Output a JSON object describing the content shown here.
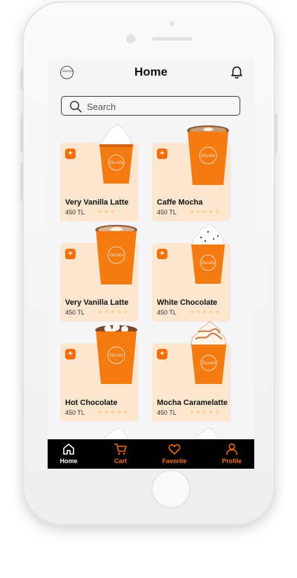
{
  "header": {
    "title": "Home",
    "logo_text": "Damla Coffee"
  },
  "search": {
    "placeholder": "Search",
    "value": ""
  },
  "products": [
    {
      "name": "Very Vanilla Latte",
      "price": "450 TL",
      "rating": 3,
      "topping": "cream"
    },
    {
      "name": "Caffe Mocha",
      "price": "450 TL",
      "rating": 5,
      "topping": "latte-art"
    },
    {
      "name": "Very Vanilla Latte",
      "price": "450 TL",
      "rating": 5,
      "topping": "latte-art"
    },
    {
      "name": "White Chocolate",
      "price": "450 TL",
      "rating": 5,
      "topping": "cream-chips"
    },
    {
      "name": "Hot Chocolate",
      "price": "450 TL",
      "rating": 5,
      "topping": "cocoa"
    },
    {
      "name": "Mocha Caramelatte",
      "price": "450 TL",
      "rating": 5,
      "topping": "caramel"
    }
  ],
  "add_label": "+",
  "tabs": [
    {
      "label": "Home",
      "icon": "home-icon",
      "active": true
    },
    {
      "label": "Cart",
      "icon": "cart-icon",
      "active": false
    },
    {
      "label": "Favorite",
      "icon": "heart-icon",
      "active": false
    },
    {
      "label": "Profile",
      "icon": "profile-icon",
      "active": false
    }
  ],
  "colors": {
    "accent": "#f46f0c",
    "card_bg": "#fde6d0",
    "star": "#fbcf8f",
    "tabbar_bg": "#000000",
    "active_tab": "#ffffff"
  }
}
